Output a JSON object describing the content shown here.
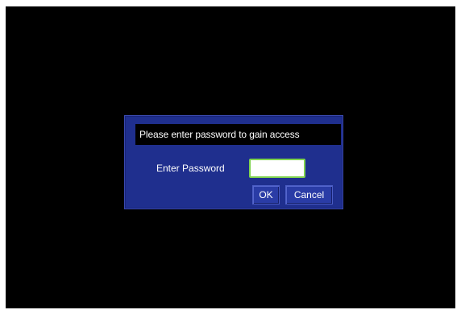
{
  "dialog": {
    "message": "Please enter password to gain access",
    "field_label": "Enter Password",
    "password_value": "",
    "ok_label": "OK",
    "cancel_label": "Cancel"
  },
  "colors": {
    "background": "#000000",
    "dialog": "#1f2f8e",
    "input_border": "#7fd34e"
  }
}
